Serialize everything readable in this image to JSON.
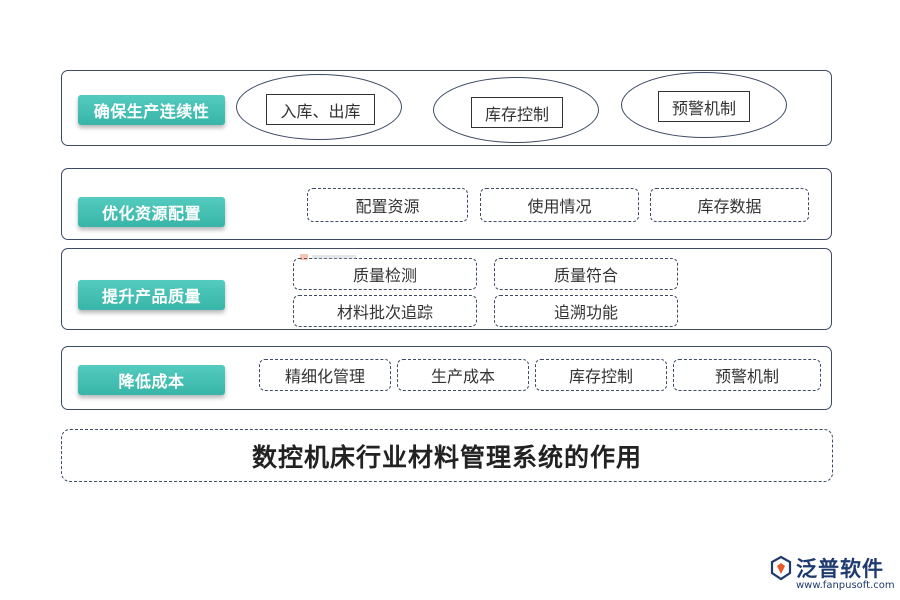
{
  "rows": [
    {
      "label": "确保生产连续性",
      "items": [
        "入库、出库",
        "库存控制",
        "预警机制"
      ]
    },
    {
      "label": "优化资源配置",
      "items": [
        "配置资源",
        "使用情况",
        "库存数据"
      ]
    },
    {
      "label": "提升产品质量",
      "items": [
        "质量检测",
        "质量符合",
        "材料批次追踪",
        "追溯功能"
      ]
    },
    {
      "label": "降低成本",
      "items": [
        "精细化管理",
        "生产成本",
        "库存控制",
        "预警机制"
      ]
    }
  ],
  "footer": {
    "title": "数控机床行业材料管理系统的作用"
  },
  "brand": {
    "name": "泛普软件",
    "url": "www.fanpusoft.com",
    "logo_icon": "fanpu-logo-icon"
  },
  "colors": {
    "label_bg": "#3fbcae",
    "border": "#3c4a63",
    "brand": "#1f3a6e",
    "logo_accent": "#e8572a"
  }
}
